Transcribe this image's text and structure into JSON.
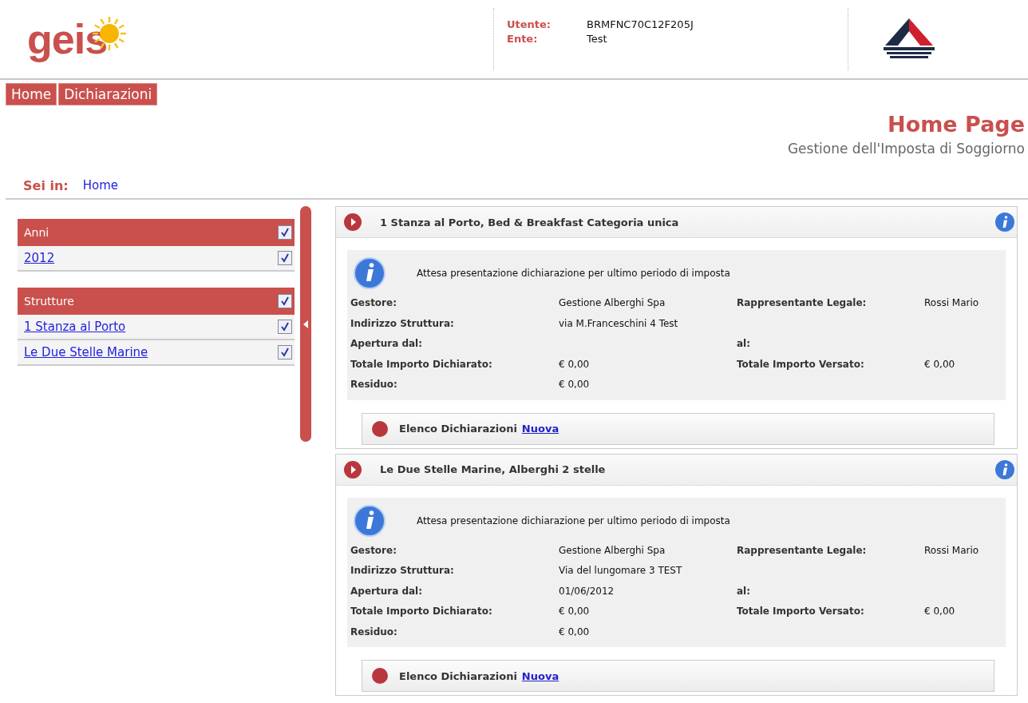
{
  "header": {
    "logo_text": "geis",
    "user": [
      {
        "label": "Utente:",
        "value": "BRMFNC70C12F205J"
      },
      {
        "label": "Ente:",
        "value": "Test"
      }
    ]
  },
  "nav": [
    {
      "label": "Home"
    },
    {
      "label": "Dichiarazioni"
    }
  ],
  "page": {
    "title": "Home Page",
    "subtitle": "Gestione dell'Imposta di Soggiorno"
  },
  "breadcrumb": {
    "label": "Sei in:",
    "items": [
      "Home"
    ]
  },
  "sidebar": {
    "groups": [
      {
        "title": "Anni",
        "checked": true,
        "items": [
          {
            "label": "2012",
            "checked": true
          }
        ]
      },
      {
        "title": "Strutture",
        "checked": true,
        "items": [
          {
            "label": "1 Stanza al Porto",
            "checked": true
          },
          {
            "label": "Le Due Stelle Marine",
            "checked": true
          }
        ]
      }
    ]
  },
  "structures": [
    {
      "title": "1 Stanza al Porto, Bed & Breakfast Categoria unica",
      "status": "Attesa presentazione dichiarazione per ultimo periodo di imposta",
      "rows": [
        {
          "label": "Gestore:",
          "value": "Gestione Alberghi Spa",
          "label2": "Rappresentante Legale:",
          "value2": "Rossi Mario"
        },
        {
          "label": "Indirizzo Struttura:",
          "value": "via M.Franceschini 4 Test"
        },
        {
          "label": "Apertura dal:",
          "label2": "al:"
        },
        {
          "label": "Totale Importo Dichiarato:",
          "value": "€ 0,00",
          "label2": "Totale Importo Versato:",
          "value2": "€ 0,00"
        },
        {
          "label": "Residuo:",
          "value": "€ 0,00"
        }
      ],
      "list_label": "Elenco Dichiarazioni",
      "list_link": "Nuova"
    },
    {
      "title": "Le Due Stelle Marine, Alberghi 2 stelle",
      "status": "Attesa presentazione dichiarazione per ultimo periodo di imposta",
      "rows": [
        {
          "label": "Gestore:",
          "value": "Gestione Alberghi Spa",
          "label2": "Rappresentante Legale:",
          "value2": "Rossi Mario"
        },
        {
          "label": "Indirizzo Struttura:",
          "value": "Via del lungomare 3 TEST"
        },
        {
          "label": "Apertura dal:",
          "value": "01/06/2012",
          "label2": "al:"
        },
        {
          "label": "Totale Importo Dichiarato:",
          "value": "€ 0,00",
          "label2": "Totale Importo Versato:",
          "value2": "€ 0,00"
        },
        {
          "label": "Residuo:",
          "value": "€ 0,00"
        }
      ],
      "list_label": "Elenco Dichiarazioni",
      "list_link": "Nuova"
    }
  ]
}
